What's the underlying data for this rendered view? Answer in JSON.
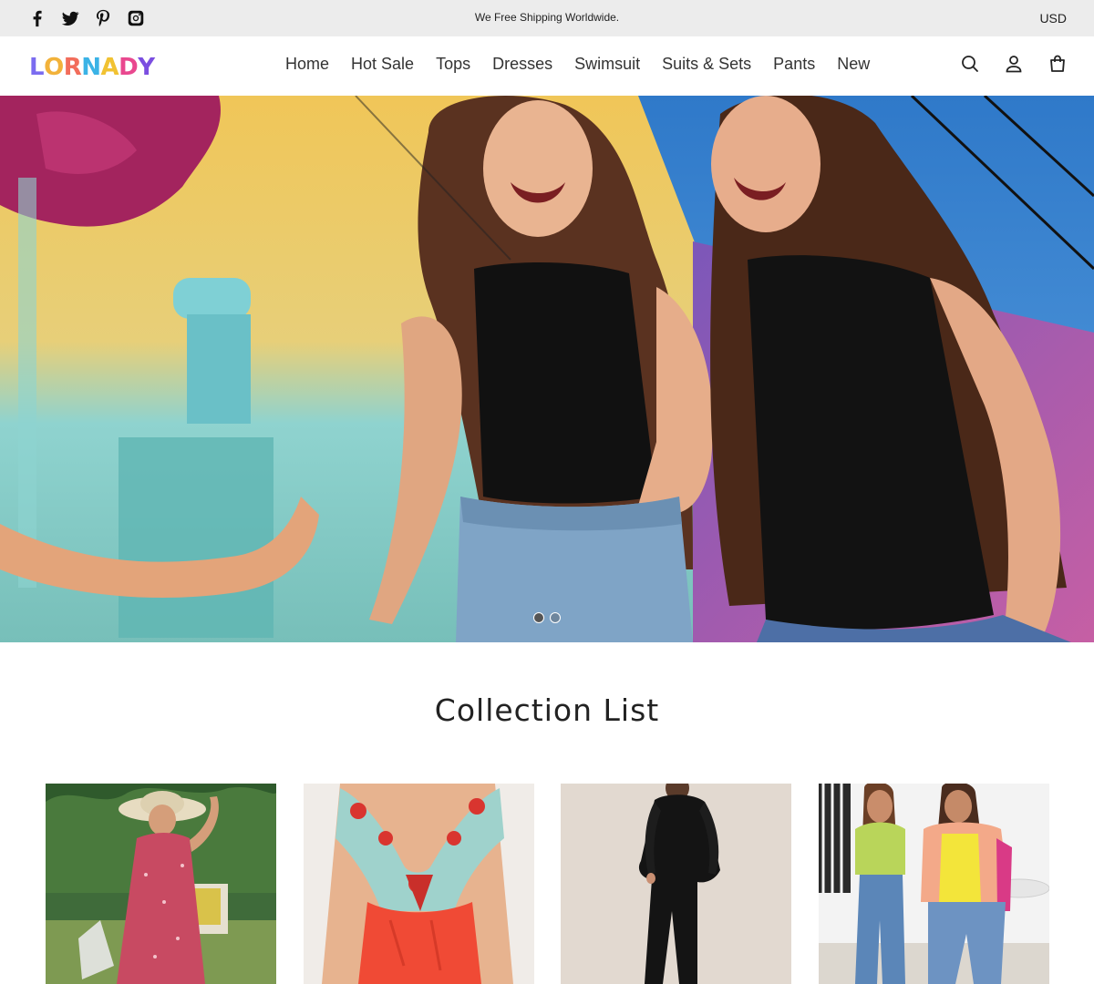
{
  "topbar": {
    "announcement": "We Free Shipping Worldwide.",
    "currency": "USD",
    "social": [
      "facebook-icon",
      "twitter-icon",
      "pinterest-icon",
      "instagram-icon"
    ]
  },
  "header": {
    "logo_text": "LORNADY",
    "logo_letters": [
      "L",
      "O",
      "R",
      "N",
      "A",
      "D",
      "Y"
    ],
    "logo_colors": [
      "#7b6cf0",
      "#f2b23a",
      "#f26d5b",
      "#3bb3e6",
      "#f1c232",
      "#e9488f",
      "#7b4ee0"
    ],
    "nav": [
      "Home",
      "Hot Sale",
      "Tops",
      "Dresses",
      "Swimsuit",
      "Suits & Sets",
      "Pants",
      "New"
    ],
    "icons": [
      "search-icon",
      "account-icon",
      "cart-icon"
    ]
  },
  "hero": {
    "slides": 2,
    "active_slide": 1
  },
  "collection": {
    "title": "Collection List",
    "items": [
      "dress-collection",
      "swimsuit-collection",
      "jumpsuit-collection",
      "tops-collection"
    ]
  },
  "colors": {
    "topbar_bg": "#ececec",
    "text": "#222222"
  }
}
